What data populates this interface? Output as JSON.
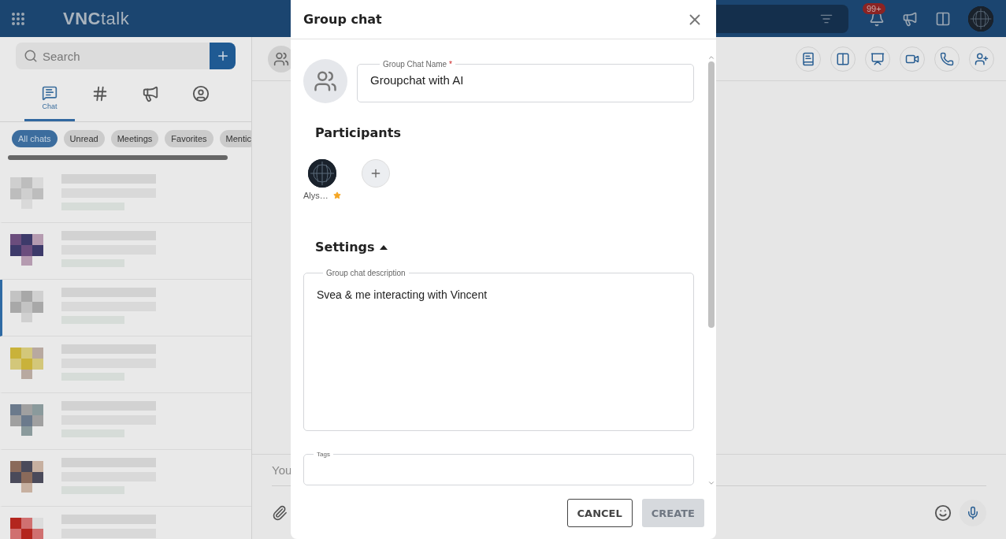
{
  "app_bar": {
    "logo_bold": "VNC",
    "logo_light": "talk",
    "notification_badge": "99+"
  },
  "sidebar": {
    "search": {
      "placeholder": "Search"
    },
    "tabs": [
      {
        "kind": "chat",
        "label": "Chat",
        "selected": true
      },
      {
        "kind": "hash",
        "selected": false
      },
      {
        "kind": "megaphone",
        "selected": false
      },
      {
        "kind": "people",
        "selected": false
      }
    ],
    "filters": [
      {
        "label": "All chats",
        "selected": true
      },
      {
        "label": "Unread",
        "selected": false
      },
      {
        "label": "Meetings",
        "selected": false
      },
      {
        "label": "Favorites",
        "selected": false
      },
      {
        "label": "Mentic",
        "selected": false
      }
    ],
    "chats": [
      {
        "kind": "picture",
        "selected": false
      },
      {
        "kind": "picture",
        "selected": false
      },
      {
        "kind": "picture",
        "selected": true
      },
      {
        "kind": "picture",
        "selected": false
      },
      {
        "kind": "picture",
        "selected": false
      },
      {
        "kind": "picture",
        "selected": false
      },
      {
        "kind": "picture",
        "selected": false
      }
    ]
  },
  "composer": {
    "placeholder": "You"
  },
  "dialog": {
    "title": "Group chat",
    "name_field": {
      "label": "Group Chat Name",
      "required_mark": "*",
      "value": "Groupchat with AI"
    },
    "participants_title": "Participants",
    "participants": [
      {
        "name": "Alys…",
        "owner": true
      }
    ],
    "settings": {
      "title": "Settings",
      "expanded": true
    },
    "description_field": {
      "label": "Group chat description",
      "value": "Svea & me interacting with Vincent"
    },
    "tags_field": {
      "label": "Tags"
    },
    "buttons": [
      {
        "label": "CANCEL",
        "disabled": false
      },
      {
        "label": "CREATE",
        "disabled": true
      }
    ]
  }
}
